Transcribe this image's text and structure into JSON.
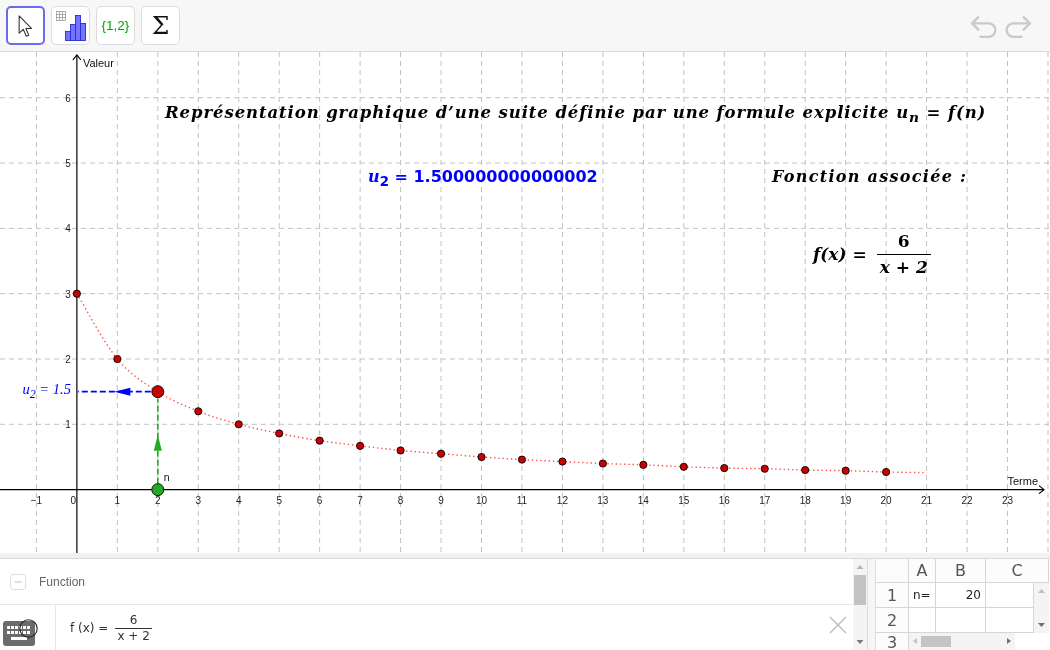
{
  "toolbar": {
    "tools": [
      {
        "kind": "pointer",
        "selected": true
      },
      {
        "kind": "bar_chart",
        "selected": false
      },
      {
        "kind": "text",
        "label": "{1,2}",
        "selected": false
      },
      {
        "kind": "symbol",
        "label": "Σ",
        "selected": false
      }
    ],
    "history": [
      {
        "kind": "undo",
        "disabled": true
      },
      {
        "kind": "redo",
        "disabled": true
      }
    ]
  },
  "graphics": {
    "title": "Représentation graphique d’une suite définie par une formule explicite u$_{n}$ = f(n)",
    "term_value": "*u*$_{2}$ = 1.500000000000002",
    "function_heading": "Fonction associée :",
    "function_formula": {
      "lhs": "f(x) =",
      "numerator": "6",
      "denominator": "x + 2"
    },
    "guides": [
      {
        "kind": "horizontal",
        "color": "#0000ff",
        "label": "*u*$_{2}$ = 1.5"
      },
      {
        "kind": "vertical",
        "color": "#22aa22"
      }
    ],
    "chart_data": {
      "type": "scatter",
      "xlabel": "Terme",
      "ylabel": "Valeur",
      "grid": true,
      "x": [
        0,
        1,
        2,
        3,
        4,
        5,
        6,
        7,
        8,
        9,
        10,
        11,
        12,
        13,
        14,
        15,
        16,
        17,
        18,
        19,
        20,
        21
      ],
      "series": [
        {
          "type": "scatter",
          "color": "#cc0000",
          "values": [
            3,
            2,
            null,
            1.2,
            1,
            0.86,
            0.75,
            0.67,
            0.6,
            0.55,
            0.5,
            0.46,
            0.43,
            0.4,
            0.38,
            0.35,
            0.33,
            0.32,
            0.3,
            0.29,
            0.27,
            null
          ]
        },
        {
          "type": "line",
          "line_style": "dotted",
          "color": "#ff5050",
          "values": [
            3,
            2,
            1.5,
            1.2,
            1,
            0.86,
            0.75,
            0.67,
            0.6,
            0.55,
            0.5,
            0.46,
            0.43,
            0.4,
            0.38,
            0.35,
            0.33,
            0.32,
            0.3,
            0.29,
            0.27,
            0.26
          ]
        },
        {
          "type": "scatter",
          "color": "#cc0000",
          "values": [
            null,
            null,
            1.5,
            null,
            null,
            null,
            null,
            null,
            null,
            null,
            null,
            null,
            null,
            null,
            null,
            null,
            null,
            null,
            null,
            null,
            null,
            null
          ]
        },
        {
          "type": "scatter",
          "name": "n",
          "color": "#22aa22",
          "values": [
            null,
            null,
            0,
            null,
            null,
            null,
            null,
            null,
            null,
            null,
            null,
            null,
            null,
            null,
            null,
            null,
            null,
            null,
            null,
            null,
            null,
            null
          ]
        }
      ],
      "xlim": [
        -1.9,
        24.05
      ],
      "ylim": [
        -0.97,
        6.7
      ],
      "xticks": [
        {
          "value": -1,
          "label": "−1"
        },
        0,
        1,
        2,
        3,
        4,
        5,
        6,
        7,
        8,
        9,
        10,
        11,
        12,
        13,
        14,
        15,
        16,
        17,
        18,
        19,
        20,
        21,
        22,
        23
      ],
      "yticks": [
        1,
        2,
        3,
        4,
        5,
        6
      ]
    }
  },
  "algebra": {
    "groups": [
      {
        "label": "Function",
        "expanded": true,
        "items": [
          {
            "lhs": "f (x) =",
            "numerator": "6",
            "denominator": "x + 2"
          }
        ]
      }
    ]
  },
  "spreadsheet": {
    "columns": [
      "A",
      "B",
      "C"
    ],
    "rows": [
      {
        "header": "1",
        "cells": [
          {
            "kind": "text",
            "value": "n="
          },
          {
            "kind": "number",
            "value": "20"
          }
        ]
      },
      {
        "header": "2"
      },
      {
        "header": "3"
      }
    ]
  }
}
